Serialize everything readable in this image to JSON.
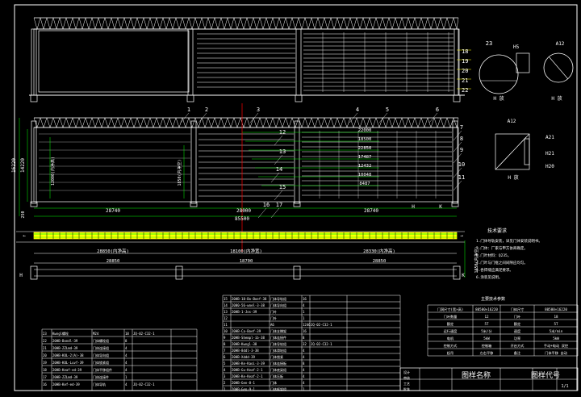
{
  "drawing": {
    "palette": {
      "background": "#000000",
      "line": "#ffffff",
      "dimension": "#00ff00",
      "callout": "#ffff00",
      "axis": "#ff0000",
      "leader": "#00ffff"
    },
    "elevation_callouts": [
      "18",
      "19",
      "20",
      "21",
      "22"
    ],
    "plan_callouts": [
      "1",
      "2",
      "3",
      "4",
      "5",
      "6",
      "7",
      "8",
      "9",
      "10",
      "11",
      "12",
      "13",
      "14",
      "15",
      "16",
      "17"
    ],
    "dims": {
      "total_width": "85500",
      "span_a": "28740",
      "span_b": "28000",
      "span_c": "28740",
      "height_total": "16220",
      "height_inner": "14220",
      "height_base": "250",
      "mid_height": "12000(内净高)",
      "inner_dim": "1850(内净空)",
      "stack": [
        "22000",
        "18500",
        "22850",
        "17487",
        "12432",
        "10048",
        "8487"
      ],
      "lower_left": "28850(内净高)",
      "lower_mid": "18100(内净宽)",
      "lower_right": "28330(内净高)",
      "lower_b1": "28850",
      "lower_b2": "18700",
      "lower_b3": "28850",
      "right_side": "1850(内净空)"
    },
    "detail_labels": [
      "23",
      "H5",
      "A12",
      "A21",
      "H20",
      "H21",
      "H 放"
    ],
    "notes_title": "技术要求",
    "notes_lines": [
      "1.门体导轨安装，详见门体安装说明书。",
      "2.门体：厂家与甲方协商确定。",
      "3.门叶材料：Q235。",
      "4.门叶与门框之间间隙应均匀。",
      "5.各焊缝应满足要求。",
      "6.涂装见说明。"
    ],
    "spec_table_title": "主要技术参数",
    "spec_table": [
      [
        "门洞尺寸(宽×高)",
        "80500×16220",
        "门体尺寸",
        "80500×16220"
      ],
      [
        "门叶数量",
        "12",
        "门叶",
        "18"
      ],
      [
        "额定",
        "5T",
        "额定",
        "5T"
      ],
      [
        "运行速度",
        "5米/分",
        "速度",
        "5米/min"
      ],
      [
        "电机",
        "5kW",
        "功率",
        "5kW"
      ],
      [
        "控制方式",
        "控制箱",
        "开启方式",
        "手动+电动 双控"
      ],
      [
        "起吊",
        "左右平移",
        "备注",
        "门体平移 自动"
      ]
    ],
    "bom_mid": [
      [
        "15",
        "20HB-18-Bo-Boef-38",
        "门体导轨组",
        "16",
        ""
      ],
      [
        "14",
        "2000-56-wnel-3-38",
        "门体导向组",
        "4",
        ""
      ],
      [
        "13",
        "20HB-1-Jos-39",
        "门叶",
        "1",
        ""
      ],
      [
        "12",
        "",
        "门叶",
        "1",
        ""
      ],
      [
        "11",
        "",
        "A6",
        "1246",
        "JQ-02-C32-1"
      ],
      [
        "10",
        "20HB-Ca-Boef-39",
        "门体支撑架",
        "16",
        ""
      ],
      [
        "9",
        "20HB-Shempl-ib-38",
        "门体连接件",
        "8",
        ""
      ],
      [
        "8",
        "20HB-Kwngl-38",
        "门体导轮组",
        "32",
        "JQ-02-C32-1"
      ],
      [
        "7",
        "20HB-8ddl-3-38",
        "门体滑轮组",
        "4",
        ""
      ],
      [
        "6",
        "20HB-Xddd-39",
        "门体锁紧",
        "4",
        ""
      ],
      [
        "5",
        "20HB-Ke-Kaoi-3-39",
        "门体连接板",
        "8",
        ""
      ],
      [
        "4",
        "20HB-Gu-Keaf-2-1",
        "门体底梁组",
        "4",
        ""
      ],
      [
        "3",
        "20HB-Ke-Keaf-2-1",
        "门体压板",
        "4",
        ""
      ],
      [
        "2",
        "20HB-Gen-8-1",
        "门体",
        "4",
        ""
      ],
      [
        "1",
        "20HB-Gen-9-1",
        "门体框架组",
        "1",
        ""
      ]
    ],
    "bom_left": [
      [
        "23",
        "Kwngl螺栓",
        "M24",
        "18",
        "JQ-02-C32-1"
      ],
      [
        "22",
        "20HB-Bondl-39",
        "门体螺栓组",
        "8",
        ""
      ],
      [
        "21",
        "20HB-ZZLmd-39",
        "门体连接组",
        "4",
        ""
      ],
      [
        "20",
        "20HB-KOL-2(A)-38",
        "门体导向组",
        "4",
        ""
      ],
      [
        "19",
        "20HB-KOL-Luvf-39",
        "门体锁紧组",
        "4",
        ""
      ],
      [
        "18",
        "20HB-Keaf-ed-39",
        "门体平移组件",
        "4",
        ""
      ],
      [
        "17",
        "20HB-ZZLmd-39",
        "门体连接件",
        "1",
        ""
      ],
      [
        "16",
        "20HB-Kef-ed-39",
        "门体导轨",
        "4",
        "JQ-02-C32-1"
      ]
    ],
    "title_block": {
      "title_cn": "图样代号",
      "title_name": "图样名称",
      "row_labels": [
        "设计",
        "审核",
        "工艺",
        "批准"
      ],
      "sheet": "1/1"
    },
    "axis_labels": [
      "H",
      "H",
      "K",
      "K"
    ]
  }
}
